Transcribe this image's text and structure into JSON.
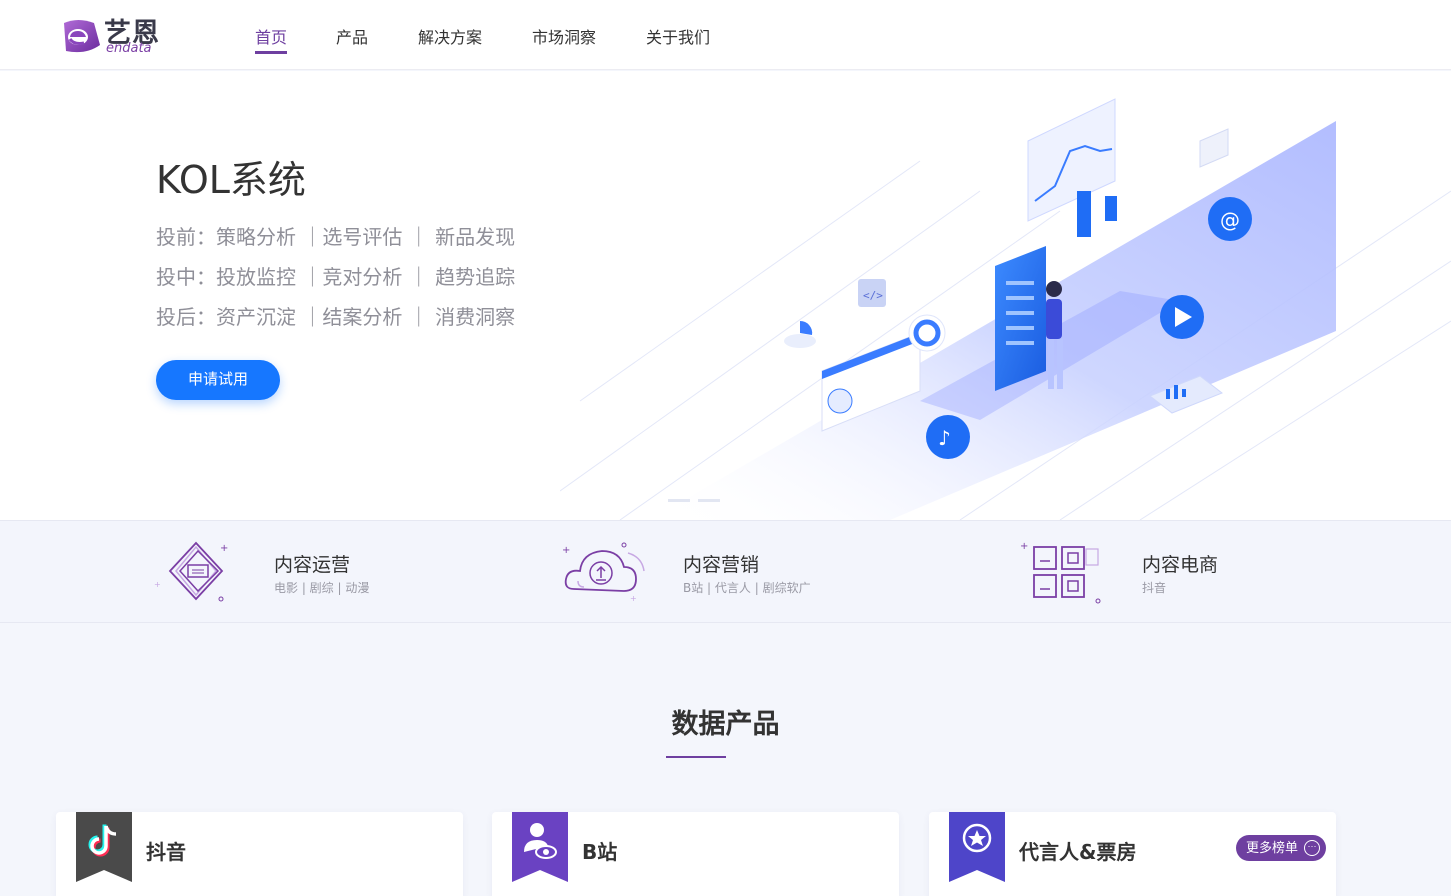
{
  "logo": {
    "cn": "艺恩",
    "en": "endata"
  },
  "nav": [
    {
      "label": "首页",
      "active": true
    },
    {
      "label": "产品",
      "active": false
    },
    {
      "label": "解决方案",
      "active": false
    },
    {
      "label": "市场洞察",
      "active": false
    },
    {
      "label": "关于我们",
      "active": false
    }
  ],
  "hero": {
    "title": "KOL系统",
    "lines": [
      "投前：策略分析 ｜选号评估 ｜ 新品发现",
      "投中：投放监控 ｜竞对分析 ｜ 趋势追踪",
      "投后：资产沉淀 ｜结案分析 ｜ 消费洞察"
    ],
    "cta": "申请试用"
  },
  "features": [
    {
      "title": "内容运营",
      "sub": "电影 | 剧综 | 动漫",
      "icon": "layered-diamond-icon"
    },
    {
      "title": "内容营销",
      "sub": "B站 | 代言人 | 剧综软广",
      "icon": "cloud-upload-icon"
    },
    {
      "title": "内容电商",
      "sub": "抖音",
      "icon": "grid-squares-icon"
    }
  ],
  "section": {
    "title": "数据产品"
  },
  "cards": [
    {
      "title": "抖音",
      "icon": "tiktok-icon",
      "ribbon_color": "#4a4a4a"
    },
    {
      "title": "B站",
      "icon": "person-eye-icon",
      "ribbon_color": "#6a42c2"
    },
    {
      "title": "代言人&票房",
      "icon": "star-badge-icon",
      "ribbon_color": "#4e45c9",
      "more": "更多榜单"
    }
  ],
  "colors": {
    "brand": "#6e3fa0",
    "primary": "#1677ff"
  }
}
